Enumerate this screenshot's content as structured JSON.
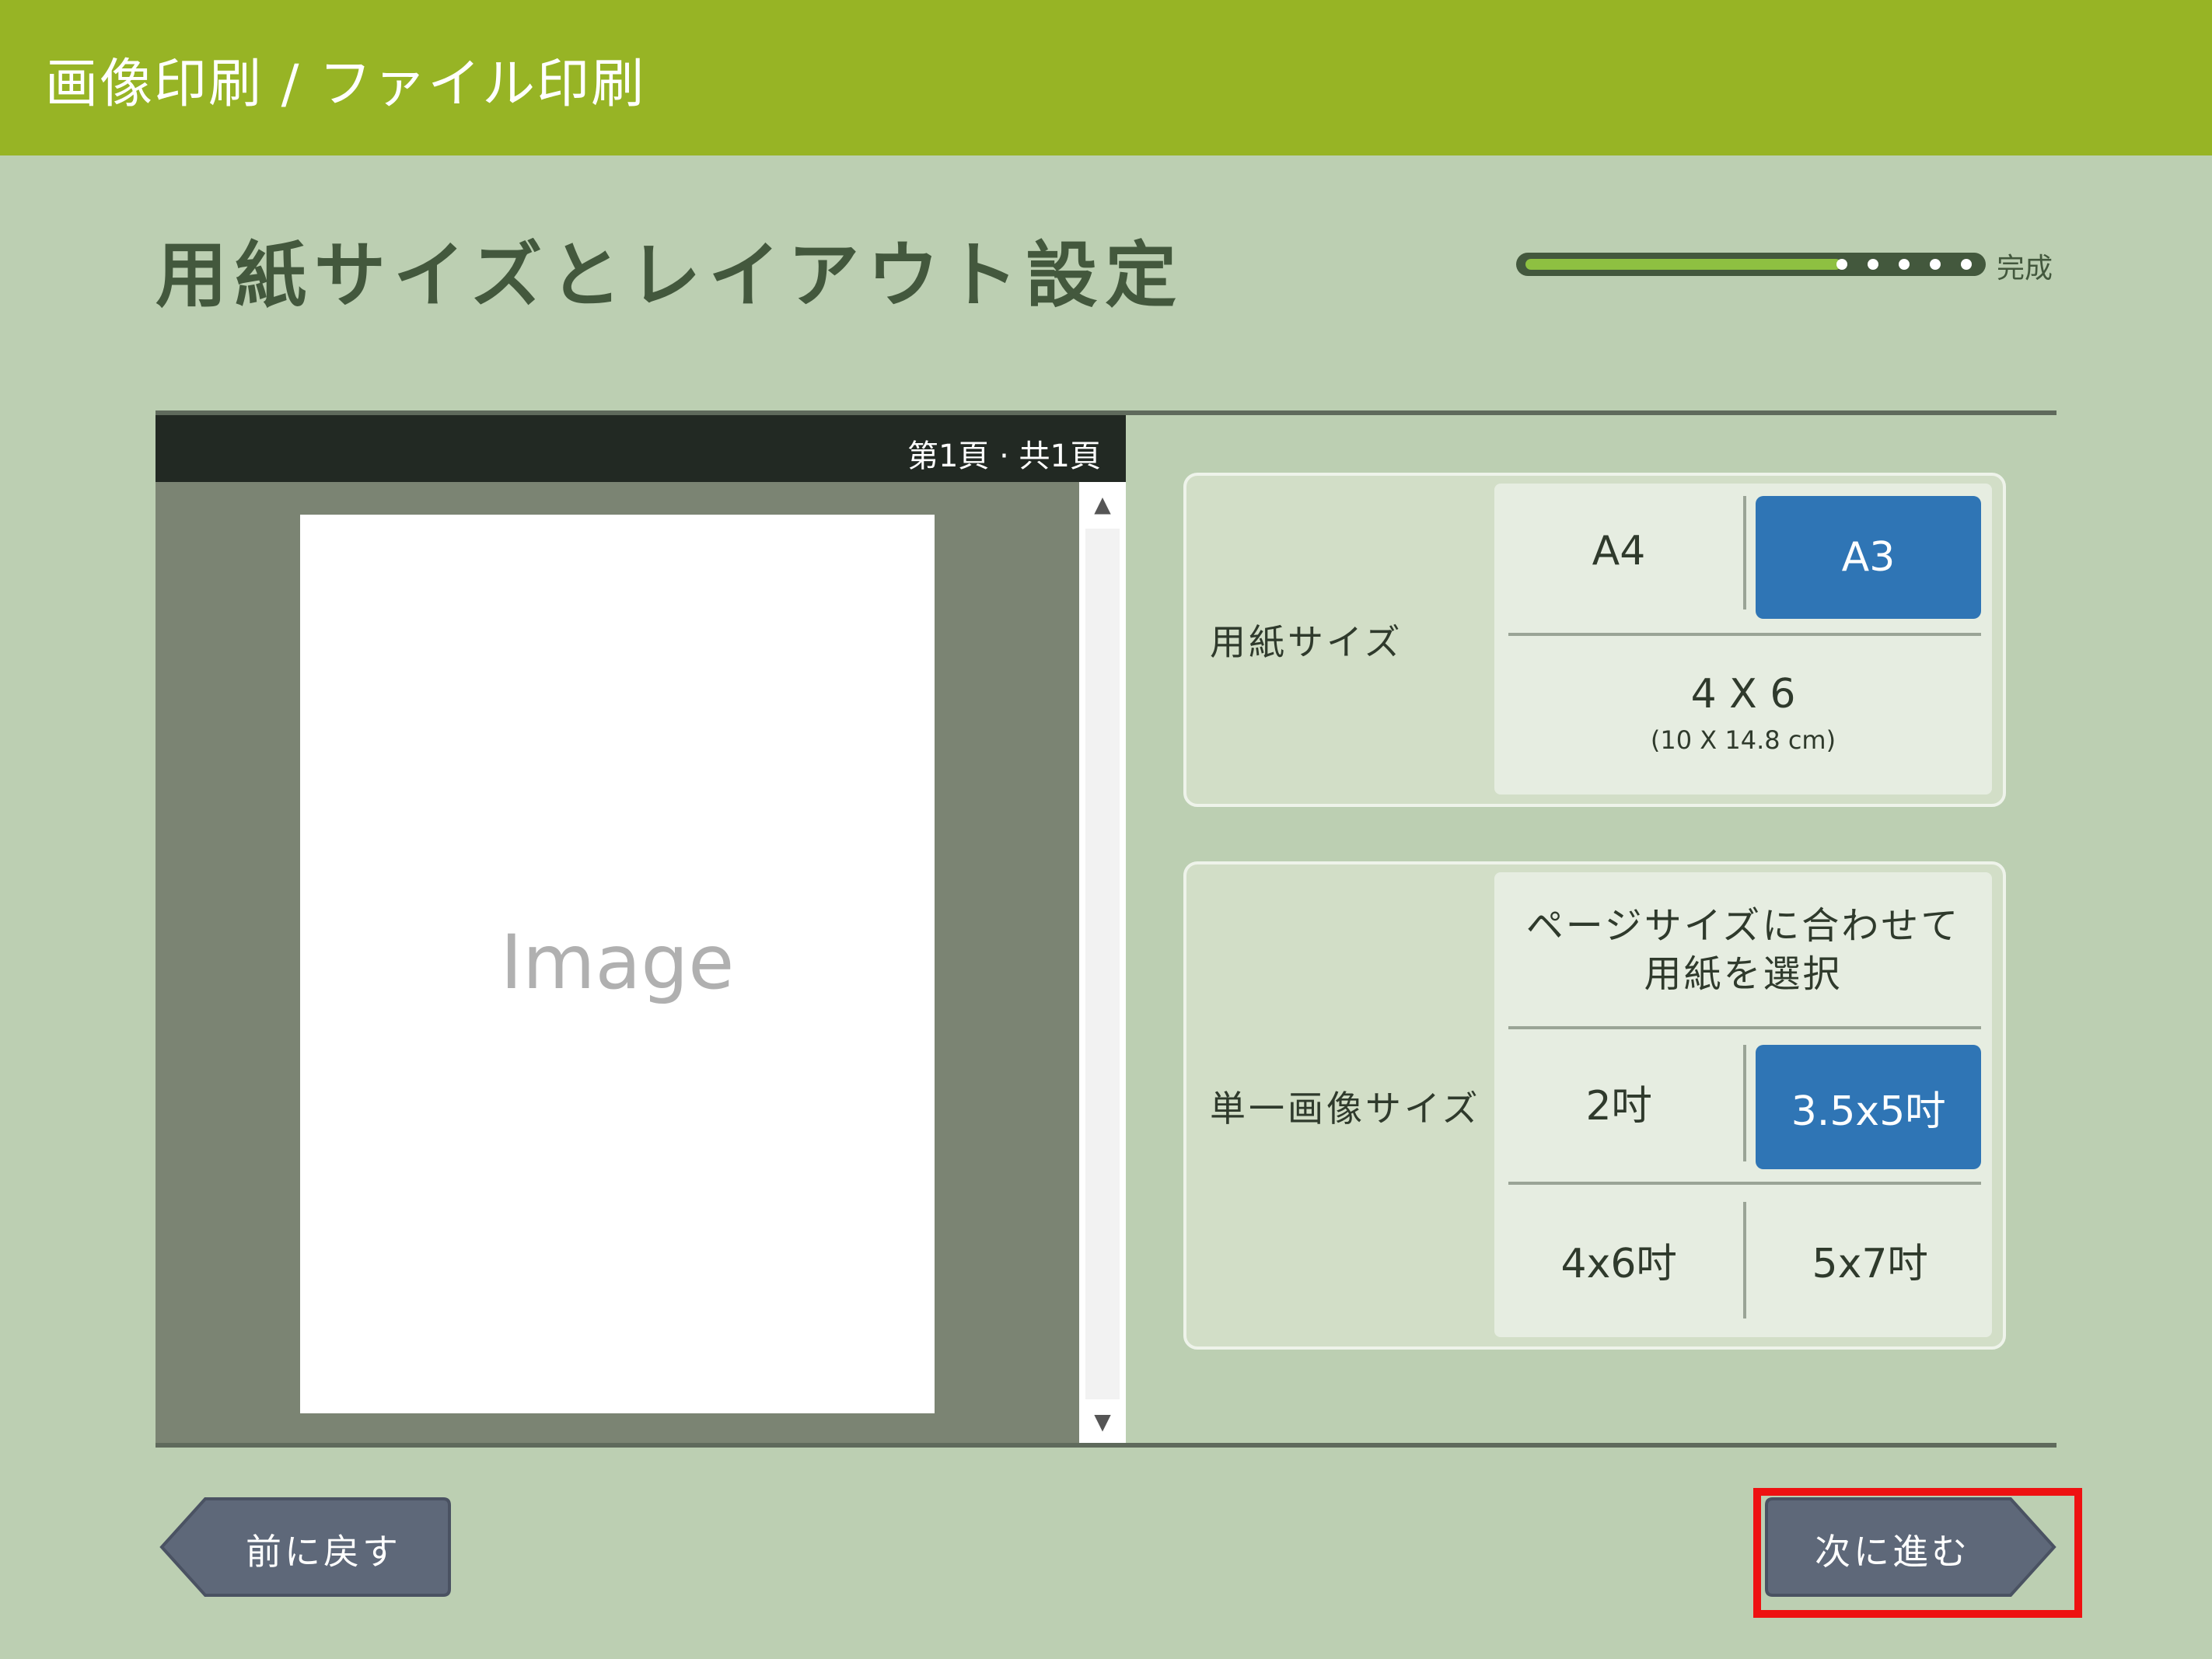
{
  "header": {
    "title": "画像印刷 / ファイル印刷"
  },
  "page": {
    "title": "用紙サイズとレイアウト設定"
  },
  "progress": {
    "label": "完成",
    "fraction": 0.7
  },
  "preview": {
    "page_indicator": "第1頁 · 共1頁",
    "placeholder": "Image"
  },
  "paper_size": {
    "label": "用紙サイズ",
    "options": [
      {
        "label": "A4",
        "selected": false
      },
      {
        "label": "A3",
        "selected": true
      },
      {
        "label": "4 X 6",
        "sub": "(10 X 14.8 cm)",
        "selected": false
      }
    ]
  },
  "image_size": {
    "label": "単一画像サイズ",
    "fit_option": "ページサイズに合わせて\n用紙を選択",
    "options": [
      {
        "label": "2吋",
        "selected": false
      },
      {
        "label": "3.5x5吋",
        "selected": true
      },
      {
        "label": "4x6吋",
        "selected": false
      },
      {
        "label": "5x7吋",
        "selected": false
      }
    ]
  },
  "nav": {
    "back_label": "前に戻す",
    "next_label": "次に進む"
  },
  "colors": {
    "accent": "#97b425",
    "selected": "#2f75b5",
    "highlight": "#ee1111"
  }
}
